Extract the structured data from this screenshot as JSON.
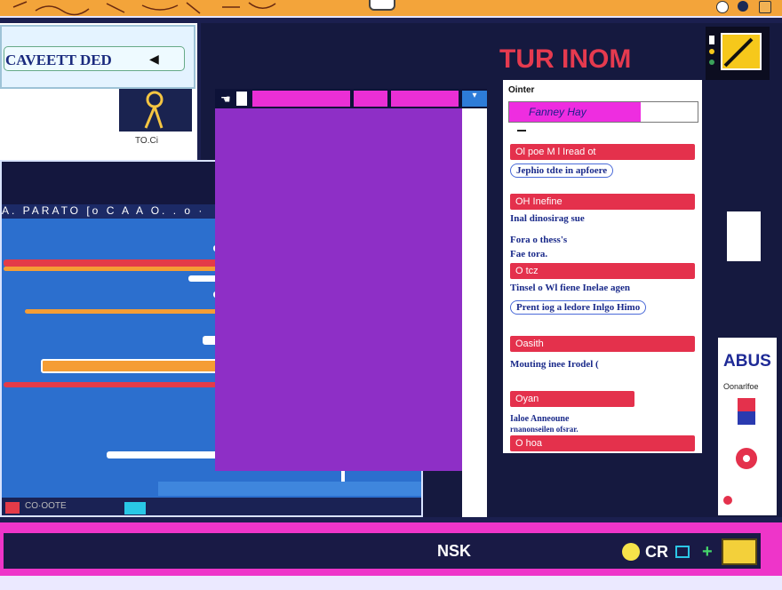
{
  "window": {
    "top_bar": {
      "icons": [
        "refresh-icon",
        "settings-icon",
        "app-icon"
      ]
    }
  },
  "left_header": {
    "title": "CAVEETT DED",
    "dropdown_icon": "triangle-left-icon",
    "thumbnail_label": "TO.Ci"
  },
  "editor": {
    "ruler_text": "A.   PARATO  [o  C  A  A  O.  .  o  ·",
    "footer_text": "CO·OOTE",
    "colors": {
      "background": "#2c6fce",
      "orange": "#f59d35",
      "red": "#e43b48",
      "white": "#ffffff"
    }
  },
  "right_panel": {
    "title": "TUR INOM",
    "section_label": "Ointer",
    "selector_text": "Fanney Hay",
    "items": [
      {
        "header": "Ol poe M l Iread ot",
        "text": "Jephio tdte in apfoere"
      },
      {
        "header": "OH Inefine",
        "text": "Inal dinosirag sue",
        "text2": "Fora o thess's",
        "text3": "Fae tora."
      },
      {
        "header": "O tcz",
        "text": "Tinsel o Wl fiene Inelae agen",
        "text2": "Prent iog a ledore Inlgo Himo"
      },
      {
        "header": "Oasith",
        "text": "Mouting inee Irodel ("
      },
      {
        "header": "Oyan",
        "text": "Ialoe Anneoune",
        "text2": "rnanonseilen ofsrar."
      },
      {
        "header": "O hoa"
      }
    ]
  },
  "far_right": {
    "abus_title": "ABUS",
    "abus_sub": "Oonarlfoe"
  },
  "bottom_bar": {
    "label": "NSK",
    "status": "CR"
  }
}
